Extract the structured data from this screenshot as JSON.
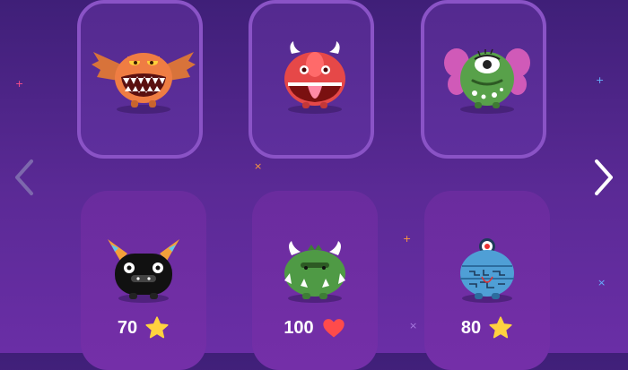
{
  "shop": {
    "monsters_unlocked": [
      {
        "name": "orange-bat-monster"
      },
      {
        "name": "red-horned-monster"
      },
      {
        "name": "green-cyclops-monster"
      }
    ],
    "monsters_for_sale": [
      {
        "price": "70",
        "currency_icon": "star-icon"
      },
      {
        "price": "100",
        "currency_icon": "heart-icon"
      },
      {
        "price": "80",
        "currency_icon": "star-icon"
      }
    ]
  },
  "navigation": {
    "prev_icon": "chevron-left-icon",
    "next_icon": "chevron-right-icon"
  },
  "colors": {
    "background_top": "#3f1f78",
    "background_bottom": "#6a2ea6",
    "card_border": "#8a53c6",
    "star": "#ffd23f",
    "heart": "#ff4b4b"
  }
}
